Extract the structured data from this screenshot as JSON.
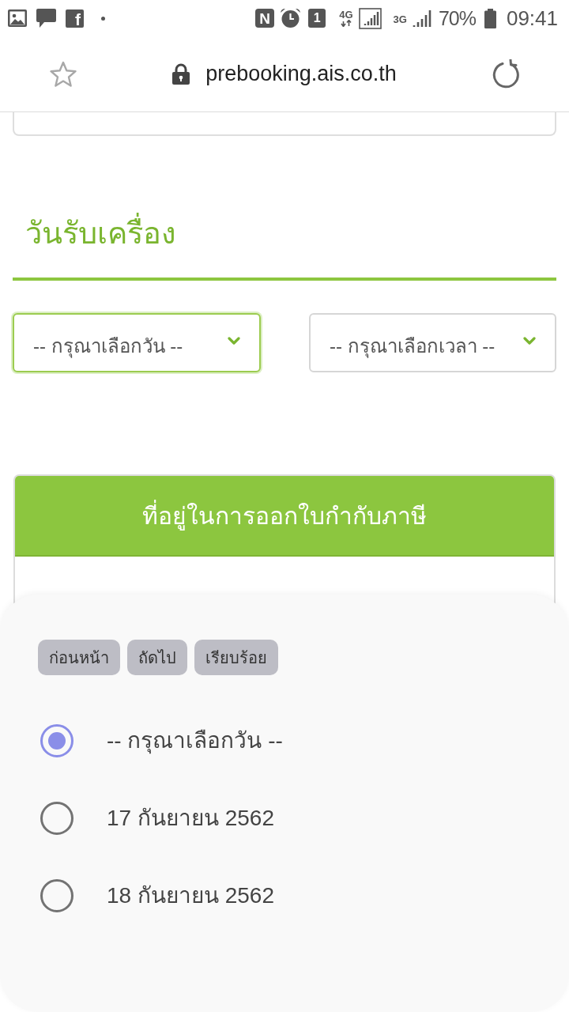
{
  "status_bar": {
    "app_badge": "f",
    "nfc_badge": "N",
    "sim_badge": "1",
    "network_1": "4G",
    "network_2": "3G",
    "battery": "70%",
    "time": "09:41"
  },
  "address_bar": {
    "url": "prebooking.ais.co.th"
  },
  "section": {
    "title": "วันรับเครื่อง"
  },
  "dropdowns": [
    {
      "value": "-- กรุณาเลือกวัน --",
      "focused": true
    },
    {
      "value": "-- กรุณาเลือกเวลา --",
      "focused": false
    }
  ],
  "card": {
    "header": "ที่อยู่ในการออกใบกำกับภาษี"
  },
  "picker": {
    "buttons": [
      "ก่อนหน้า",
      "ถัดไป",
      "เรียบร้อย"
    ],
    "options": [
      {
        "label": "-- กรุณาเลือกวัน --",
        "selected": true
      },
      {
        "label": "17 กันยายน 2562",
        "selected": false
      },
      {
        "label": "18 กันยายน 2562",
        "selected": false
      }
    ]
  }
}
